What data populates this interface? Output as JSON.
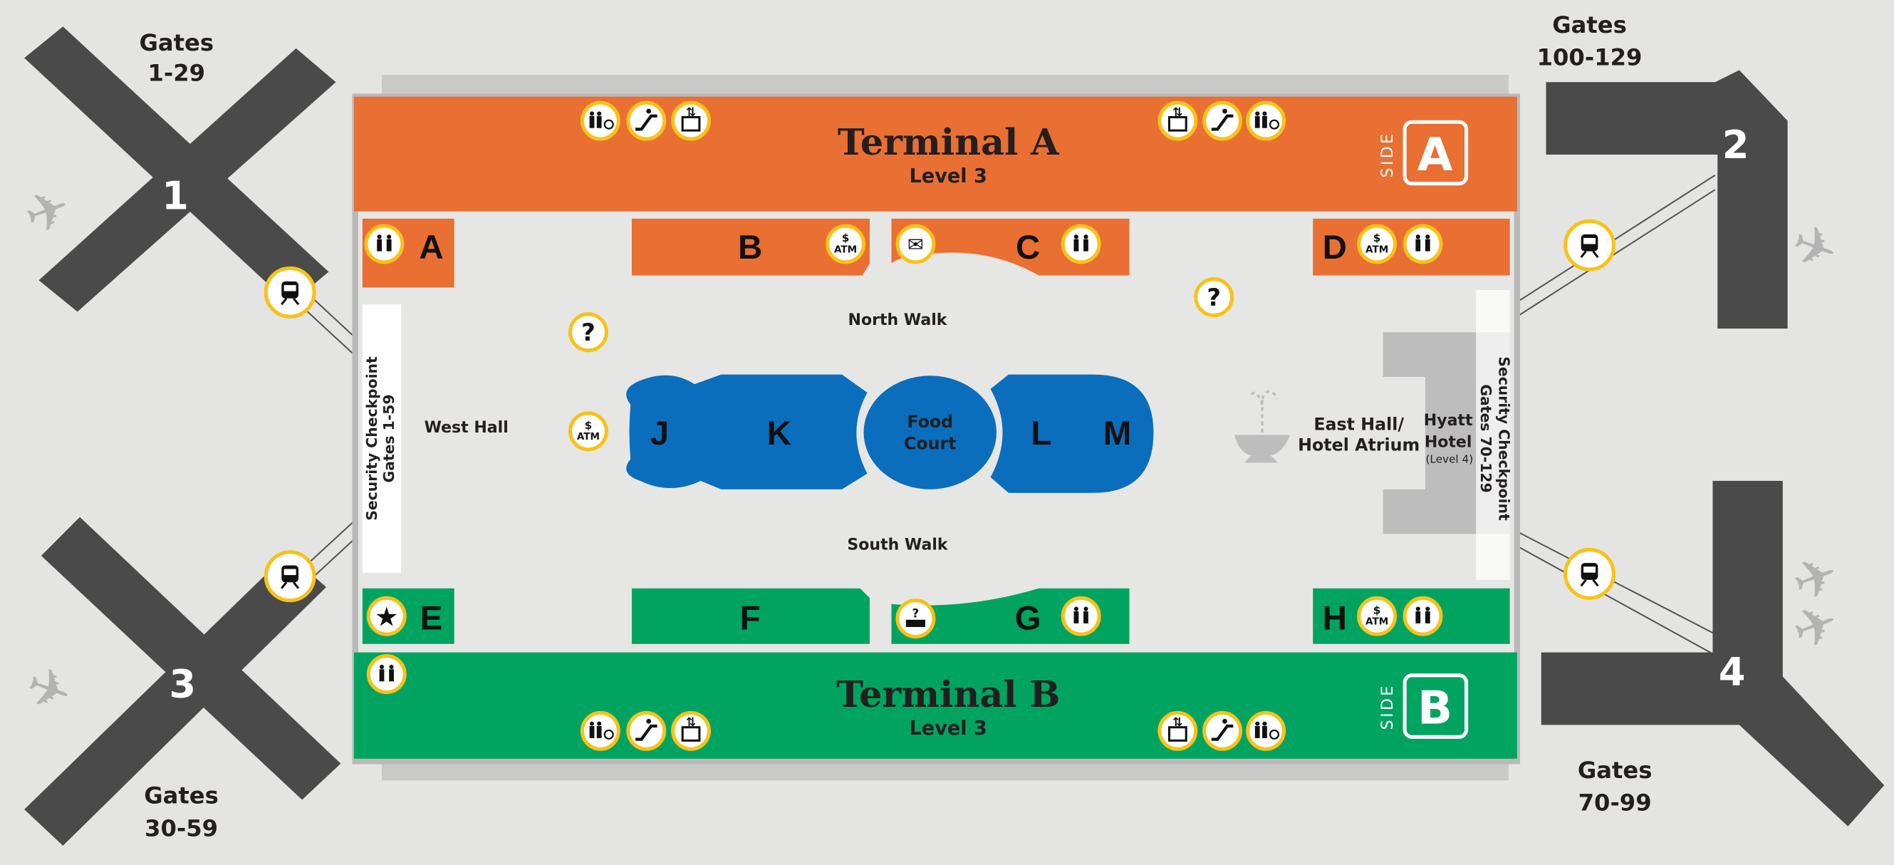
{
  "colors": {
    "terminal_a": "#e96f33",
    "terminal_b": "#00a460",
    "food_court": "#0a6ebd",
    "pier": "#4a4a4a",
    "icon_ring": "#f7c21a",
    "floor": "#e6e6e4",
    "hotel": "#bdbdbd"
  },
  "terminals": [
    {
      "title": "Terminal A",
      "level": "Level 3",
      "side_word": "SIDE",
      "side_letter": "A"
    },
    {
      "title": "Terminal B",
      "level": "Level 3",
      "side_word": "SIDE",
      "side_letter": "B"
    }
  ],
  "piers": [
    {
      "number": "1",
      "gates_line1": "Gates",
      "gates_line2": "1-29"
    },
    {
      "number": "2",
      "gates_line1": "Gates",
      "gates_line2": "100-129"
    },
    {
      "number": "3",
      "gates_line1": "Gates",
      "gates_line2": "30-59"
    },
    {
      "number": "4",
      "gates_line1": "Gates",
      "gates_line2": "70-99"
    }
  ],
  "concourse_sections": [
    "A",
    "B",
    "C",
    "D",
    "E",
    "F",
    "G",
    "H"
  ],
  "food_court": {
    "sections": [
      "J",
      "K",
      "L",
      "M"
    ],
    "center_line1": "Food",
    "center_line2": "Court"
  },
  "areas": {
    "north_walk": "North Walk",
    "south_walk": "South Walk",
    "west_hall": "West Hall",
    "east_hall_line1": "East Hall/",
    "east_hall_line2": "Hotel Atrium",
    "hyatt_line1": "Hyatt",
    "hyatt_line2": "Hotel",
    "hyatt_line3": "(Level 4)",
    "security_west_line1": "Security Checkpoint",
    "security_west_line2": "Gates 1-59",
    "security_east_line1": "Security Checkpoint",
    "security_east_line2": "Gates 70-129"
  },
  "amenities": [
    {
      "icon": "restroom-accessible"
    },
    {
      "icon": "escalator"
    },
    {
      "icon": "elevator"
    },
    {
      "icon": "elevator"
    },
    {
      "icon": "escalator"
    },
    {
      "icon": "restroom-accessible"
    },
    {
      "icon": "restroom"
    },
    {
      "icon": "atm",
      "text": "ATM"
    },
    {
      "icon": "mail"
    },
    {
      "icon": "restroom"
    },
    {
      "icon": "atm",
      "text": "ATM"
    },
    {
      "icon": "restroom"
    },
    {
      "icon": "info",
      "text": "?"
    },
    {
      "icon": "atm",
      "text": "ATM"
    },
    {
      "icon": "info",
      "text": "?"
    },
    {
      "icon": "star"
    },
    {
      "icon": "info-desk"
    },
    {
      "icon": "restroom"
    },
    {
      "icon": "atm",
      "text": "ATM"
    },
    {
      "icon": "restroom"
    },
    {
      "icon": "restroom"
    },
    {
      "icon": "restroom-accessible"
    },
    {
      "icon": "escalator"
    },
    {
      "icon": "elevator"
    },
    {
      "icon": "elevator"
    },
    {
      "icon": "escalator"
    },
    {
      "icon": "restroom-accessible"
    },
    {
      "icon": "train"
    },
    {
      "icon": "train"
    },
    {
      "icon": "train"
    },
    {
      "icon": "train"
    }
  ]
}
